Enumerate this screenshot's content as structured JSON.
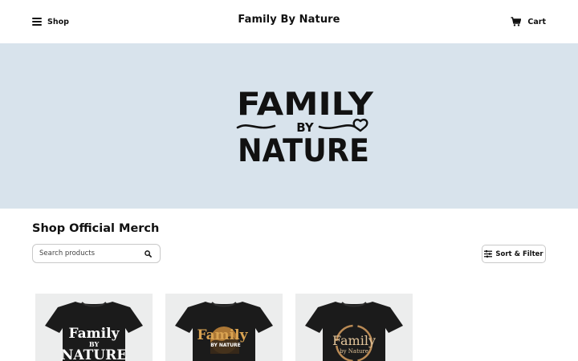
{
  "header": {
    "shop_label": "Shop",
    "store_title": "Family By Nature",
    "cart_label": "Cart"
  },
  "hero": {
    "logo_lines": [
      "FAMILY",
      "BY",
      "NATURE"
    ],
    "background_color": "#d8e3ec"
  },
  "main": {
    "section_title": "Shop Official Merch",
    "search_placeholder": "Search products",
    "sort_filter_label": "Sort & Filter"
  },
  "products": [
    {
      "print_lines": [
        "Family",
        "BY",
        "NATURE"
      ],
      "print_color": "#ffffff"
    },
    {
      "print_lines": [
        "Family",
        "BY NATURE"
      ],
      "print_color": "#d9a352"
    },
    {
      "print_lines": [
        "Family",
        "by Nature"
      ],
      "print_color": "#e2c49a"
    }
  ],
  "icons": {
    "menu": "hamburger-icon",
    "cart": "cart-icon",
    "search": "search-icon",
    "filter": "sliders-icon"
  }
}
